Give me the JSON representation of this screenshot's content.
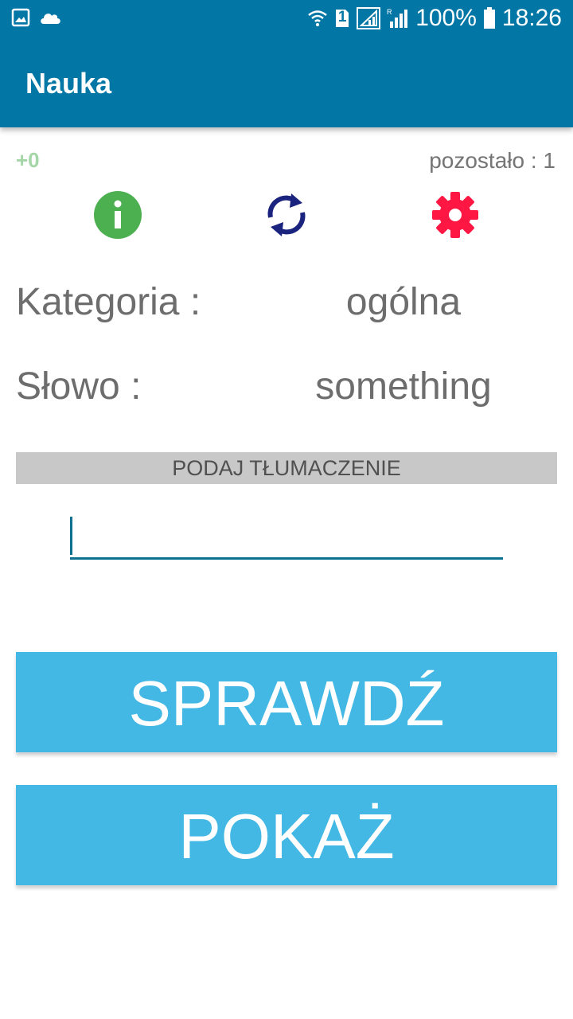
{
  "status_bar": {
    "battery": "100%",
    "time": "18:26",
    "sim_badge": "1",
    "icons": [
      "image-icon",
      "cloud-icon",
      "wifi-icon",
      "sim-icon",
      "signal-roaming-icon",
      "signal-icon",
      "battery-icon"
    ]
  },
  "app_bar": {
    "title": "Nauka",
    "color": "#0277a6"
  },
  "score": {
    "value": "+0",
    "color": "#a5d6a7"
  },
  "remaining": {
    "text": "pozostało : 1"
  },
  "toolbar_icons": {
    "info": {
      "name": "info-icon",
      "color": "#4caf50"
    },
    "refresh": {
      "name": "refresh-icon",
      "color": "#1a237e"
    },
    "settings": {
      "name": "gear-icon",
      "color": "#ff1744"
    }
  },
  "category": {
    "label": "Kategoria :",
    "value": "ogólna"
  },
  "word": {
    "label": "Słowo :",
    "value": "something"
  },
  "prompt_banner": {
    "text": "PODAJ TŁUMACZENIE"
  },
  "answer_input": {
    "value": "",
    "placeholder": ""
  },
  "buttons": {
    "check": "SPRAWDŹ",
    "show": "POKAŻ",
    "color": "#43b8e4"
  }
}
